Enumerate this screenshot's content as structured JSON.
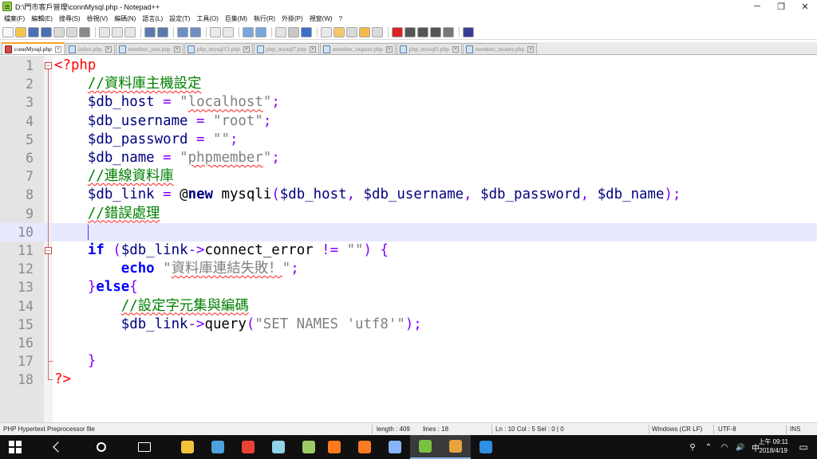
{
  "window": {
    "title": "D:\\門市客戶管理\\connMysql.php - Notepad++",
    "minimize_glyph": "─",
    "maximize_glyph": "❐",
    "close_glyph": "✕"
  },
  "menu": [
    "檔案(F)",
    "編輯(E)",
    "搜尋(S)",
    "檢視(V)",
    "編碼(N)",
    "語言(L)",
    "設定(T)",
    "工具(O)",
    "巨集(M)",
    "執行(R)",
    "外掛(P)",
    "視窗(W)",
    "?"
  ],
  "toolbar_icons": [
    "new-file-icon",
    "open-file-icon",
    "save-icon",
    "save-all-icon",
    "close-icon",
    "close-all-icon",
    "print-icon",
    "cut-icon",
    "copy-icon",
    "paste-icon",
    "undo-icon",
    "redo-icon",
    "find-icon",
    "replace-icon",
    "zoom-in-icon",
    "zoom-out-icon",
    "sync-vertical-icon",
    "sync-horizontal-icon",
    "word-wrap-icon",
    "show-all-chars-icon",
    "indent-guide-icon",
    "user-language-icon",
    "document-map-icon",
    "function-list-icon",
    "folder-workspace-icon",
    "monitor-icon",
    "record-macro-icon",
    "stop-macro-icon",
    "playback-macro-icon",
    "run-macro-multiple-icon",
    "save-macro-icon",
    "spell-check-icon"
  ],
  "tabs": [
    {
      "label": "connMysql.php",
      "active": true
    },
    {
      "label": "index.php",
      "active": false
    },
    {
      "label": "member_join.php",
      "active": false
    },
    {
      "label": "php_mysql13.php",
      "active": false
    },
    {
      "label": "php_mysql7.php",
      "active": false
    },
    {
      "label": "member_inquire.php",
      "active": false
    },
    {
      "label": "php_mysql1.php",
      "active": false
    },
    {
      "label": "member_money.php",
      "active": false
    }
  ],
  "close_glyph": "×",
  "fold_open": "−",
  "editor": {
    "current_line": 10,
    "line_numbers": [
      "1",
      "2",
      "3",
      "4",
      "5",
      "6",
      "7",
      "8",
      "9",
      "10",
      "11",
      "12",
      "13",
      "14",
      "15",
      "16",
      "17",
      "18"
    ],
    "lines": [
      [
        {
          "t": "<?php",
          "c": "c-tag"
        }
      ],
      [
        {
          "t": "    "
        },
        {
          "t": "//資料庫主機設定",
          "c": "c-comment squiggle"
        }
      ],
      [
        {
          "t": "    "
        },
        {
          "t": "$db_host",
          "c": "c-var"
        },
        {
          "t": " "
        },
        {
          "t": "=",
          "c": "c-op"
        },
        {
          "t": " "
        },
        {
          "t": "\"",
          "c": "c-str"
        },
        {
          "t": "localhost",
          "c": "c-str squiggle"
        },
        {
          "t": "\"",
          "c": "c-str"
        },
        {
          "t": ";",
          "c": "c-op"
        }
      ],
      [
        {
          "t": "    "
        },
        {
          "t": "$db_username",
          "c": "c-var"
        },
        {
          "t": " "
        },
        {
          "t": "=",
          "c": "c-op"
        },
        {
          "t": " "
        },
        {
          "t": "\"root\"",
          "c": "c-str"
        },
        {
          "t": ";",
          "c": "c-op"
        }
      ],
      [
        {
          "t": "    "
        },
        {
          "t": "$db_password",
          "c": "c-var"
        },
        {
          "t": " "
        },
        {
          "t": "=",
          "c": "c-op"
        },
        {
          "t": " "
        },
        {
          "t": "\"\"",
          "c": "c-str"
        },
        {
          "t": ";",
          "c": "c-op"
        }
      ],
      [
        {
          "t": "    "
        },
        {
          "t": "$db_name",
          "c": "c-var"
        },
        {
          "t": " "
        },
        {
          "t": "=",
          "c": "c-op"
        },
        {
          "t": " "
        },
        {
          "t": "\"",
          "c": "c-str"
        },
        {
          "t": "phpmember",
          "c": "c-str squiggle"
        },
        {
          "t": "\"",
          "c": "c-str"
        },
        {
          "t": ";",
          "c": "c-op"
        }
      ],
      [
        {
          "t": "    "
        },
        {
          "t": "//連線資料庫",
          "c": "c-comment squiggle"
        }
      ],
      [
        {
          "t": "    "
        },
        {
          "t": "$db_link",
          "c": "c-var"
        },
        {
          "t": " "
        },
        {
          "t": "=",
          "c": "c-op"
        },
        {
          "t": " "
        },
        {
          "t": "@",
          "c": "c-at"
        },
        {
          "t": "new",
          "c": "c-new"
        },
        {
          "t": " mysqli",
          "c": "c-plain"
        },
        {
          "t": "(",
          "c": "c-op"
        },
        {
          "t": "$db_host",
          "c": "c-var"
        },
        {
          "t": ", ",
          "c": "c-op"
        },
        {
          "t": "$db_username",
          "c": "c-var"
        },
        {
          "t": ", ",
          "c": "c-op"
        },
        {
          "t": "$db_password",
          "c": "c-var"
        },
        {
          "t": ", ",
          "c": "c-op"
        },
        {
          "t": "$db_name",
          "c": "c-var"
        },
        {
          "t": ");",
          "c": "c-op"
        }
      ],
      [
        {
          "t": "    "
        },
        {
          "t": "//錯誤處理",
          "c": "c-comment squiggle"
        }
      ],
      [
        {
          "t": "    "
        }
      ],
      [
        {
          "t": "    "
        },
        {
          "t": "if",
          "c": "c-kw"
        },
        {
          "t": " "
        },
        {
          "t": "(",
          "c": "c-op"
        },
        {
          "t": "$db_link",
          "c": "c-var"
        },
        {
          "t": "->",
          "c": "c-op"
        },
        {
          "t": "connect_error",
          "c": "c-plain"
        },
        {
          "t": " "
        },
        {
          "t": "!=",
          "c": "c-op"
        },
        {
          "t": " "
        },
        {
          "t": "\"\"",
          "c": "c-str"
        },
        {
          "t": ")",
          "c": "c-op"
        },
        {
          "t": " "
        },
        {
          "t": "{",
          "c": "c-op"
        }
      ],
      [
        {
          "t": "        "
        },
        {
          "t": "echo",
          "c": "c-kw"
        },
        {
          "t": " "
        },
        {
          "t": "\"",
          "c": "c-str"
        },
        {
          "t": "資料庫連結失敗！",
          "c": "c-str squiggle"
        },
        {
          "t": "\"",
          "c": "c-str"
        },
        {
          "t": ";",
          "c": "c-op"
        }
      ],
      [
        {
          "t": "    "
        },
        {
          "t": "}",
          "c": "c-op"
        },
        {
          "t": "else",
          "c": "c-kw"
        },
        {
          "t": "{",
          "c": "c-op"
        }
      ],
      [
        {
          "t": "        "
        },
        {
          "t": "//設定字元集與編碼",
          "c": "c-comment squiggle"
        }
      ],
      [
        {
          "t": "        "
        },
        {
          "t": "$db_link",
          "c": "c-var"
        },
        {
          "t": "->",
          "c": "c-op"
        },
        {
          "t": "query",
          "c": "c-plain"
        },
        {
          "t": "(",
          "c": "c-op"
        },
        {
          "t": "\"SET NAMES 'utf8'\"",
          "c": "c-str"
        },
        {
          "t": ");",
          "c": "c-op"
        }
      ],
      [
        {
          "t": ""
        }
      ],
      [
        {
          "t": "    "
        },
        {
          "t": "}",
          "c": "c-op"
        }
      ],
      [
        {
          "t": "?>",
          "c": "c-tag"
        }
      ]
    ]
  },
  "status": {
    "file_type": "PHP Hypertext Preprocessor file",
    "length": "length : 409",
    "lines": "lines : 18",
    "position": "Ln : 10   Col : 5   Sel : 0 | 0",
    "eol": "Windows (CR LF)",
    "encoding": "UTF-8",
    "mode": "INS"
  },
  "taskbar": {
    "apps": [
      "start-icon",
      "back-icon",
      "search-icon",
      "task-view-icon",
      "file-explorer-icon",
      "media-player-icon",
      "google-icon",
      "app-icon",
      "zune-icon",
      "firefox-icon",
      "xampp-icon",
      "virtualbox-icon",
      "notepadpp-icon",
      "chrome-icon",
      "edge-icon"
    ],
    "tray": {
      "ime": "中",
      "people_glyph": "⚲",
      "arrow_glyph": "⌃",
      "volume_glyph": "🔊",
      "wifi_glyph": "◠"
    },
    "clock_time": "上午 09:11",
    "clock_date": "2018/4/19"
  },
  "colors": {
    "php_tag": "#ff0000",
    "comment": "#008000",
    "variable": "#000080",
    "operator": "#8000ff",
    "string": "#808080",
    "keyword": "#0000ff",
    "current_line": "#e8e8ff",
    "active_tab_accent": "#f5a623"
  }
}
